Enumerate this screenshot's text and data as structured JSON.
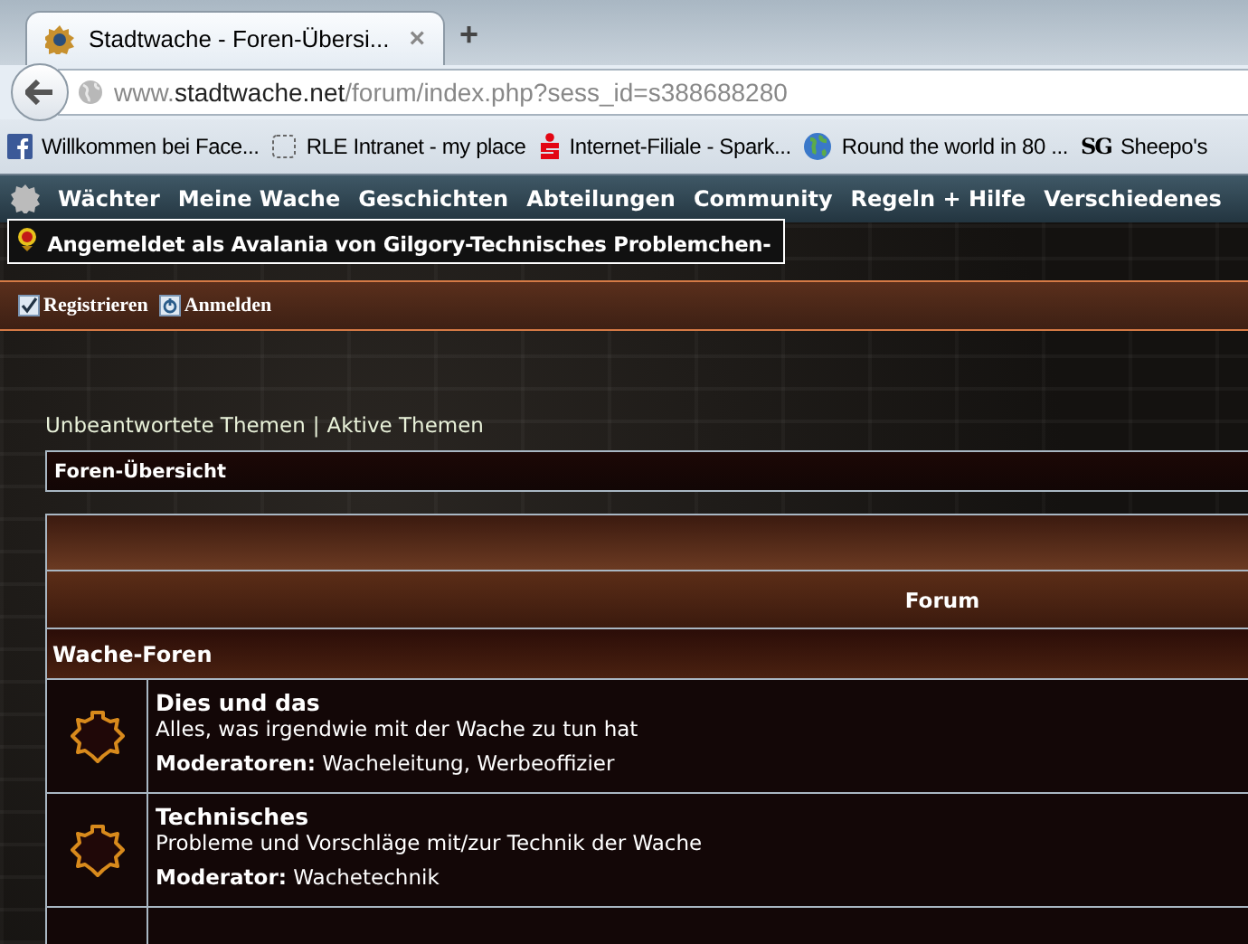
{
  "browser": {
    "tab": {
      "title": "Stadtwache - Foren-Übersi...",
      "close": "×",
      "selected": true
    },
    "new_tab": "+",
    "url": "www.**stadtwache.net**/forum/index.php?sess_id=s388688280",
    "bookmarks": [
      {
        "kind": "facebook",
        "label": "Willkommen bei Face..."
      },
      {
        "kind": "page",
        "label": "RLE Intranet - my place"
      },
      {
        "kind": "bank",
        "label": "Internet-Filiale - Spark..."
      },
      {
        "kind": "globe",
        "label": "Round the world in 80 ..."
      },
      {
        "kind": "letters",
        "icon_text": "SG",
        "label": "Sheepo's"
      }
    ]
  },
  "nav": {
    "items": [
      "Wächter",
      "Meine Wache",
      "Geschichten",
      "Abteilungen",
      "Community",
      "Regeln + Hilfe",
      "Verschiedenes"
    ]
  },
  "login_status": "Angemeldet als Avalania von Gilgory-Technisches Problemchen-",
  "account_links": [
    {
      "kind": "register",
      "label": "Registrieren"
    },
    {
      "kind": "login",
      "label": "Anmelden"
    }
  ],
  "quick_links": [
    "Unbeantwortete Themen",
    "Aktive Themen"
  ],
  "quick_links_separator": "|",
  "breadcrumb": "Foren-Übersicht",
  "table": {
    "columns": [
      "Forum"
    ],
    "category": "Wache-Foren",
    "rows": [
      {
        "name": "Dies und das",
        "description": "Alles, was irgendwie mit der Wache zu tun hat",
        "moderators": "**Moderatoren:** Wacheleitung, Werbeoffizier"
      },
      {
        "name": "Technisches",
        "description": "Probleme und Vorschläge mit/zur Technik der Wache",
        "moderators": "**Moderator:** Wachetechnik"
      }
    ]
  }
}
